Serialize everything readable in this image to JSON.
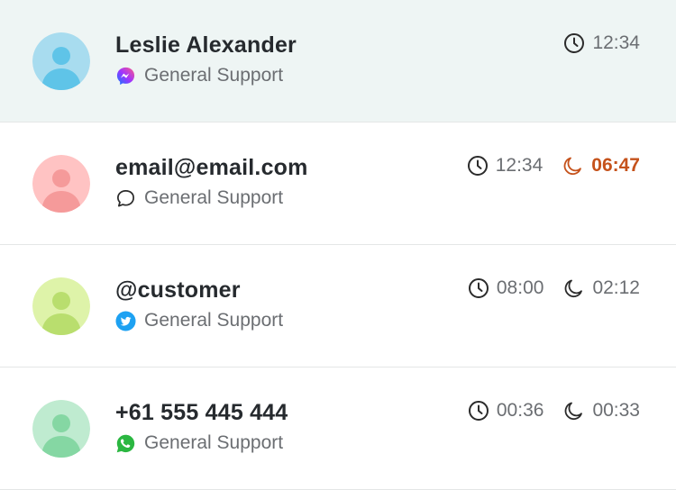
{
  "conversations": [
    {
      "name": "Leslie Alexander",
      "channel": "General Support",
      "channel_icon": "messenger-icon",
      "avatar_color": "#a8dcef",
      "avatar_silhouette": "#5fc4e8",
      "wait_time": "12:34",
      "sla_time": null,
      "sla_overdue": false,
      "active": true
    },
    {
      "name": "email@email.com",
      "channel": "General Support",
      "channel_icon": "chat-bubble-icon",
      "avatar_color": "#ffc3c3",
      "avatar_silhouette": "#f59a9a",
      "wait_time": "12:34",
      "sla_time": "06:47",
      "sla_overdue": true,
      "active": false
    },
    {
      "name": "@customer",
      "channel": "General Support",
      "channel_icon": "twitter-icon",
      "avatar_color": "#def3a9",
      "avatar_silhouette": "#b9de6e",
      "wait_time": "08:00",
      "sla_time": "02:12",
      "sla_overdue": false,
      "active": false
    },
    {
      "name": "+61 555 445 444",
      "channel": "General Support",
      "channel_icon": "whatsapp-icon",
      "avatar_color": "#bfebd0",
      "avatar_silhouette": "#85d7a3",
      "wait_time": "00:36",
      "sla_time": "00:33",
      "sla_overdue": false,
      "active": false
    }
  ],
  "colors": {
    "active_row": "#eef5f4",
    "overdue": "#c5521b",
    "muted_text": "#6b6e72",
    "name_text": "#262a2e"
  }
}
